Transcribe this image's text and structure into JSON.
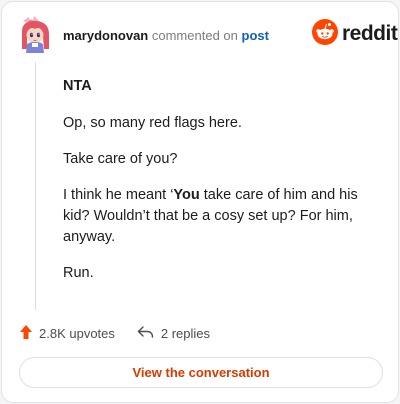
{
  "header": {
    "username": "marydonovan",
    "action_text": "commented on",
    "post_link": "post",
    "brand": "reddit"
  },
  "comment": {
    "title": "NTA",
    "paragraph_1": "Op, so many red flags here.",
    "paragraph_2": "Take care of you?",
    "paragraph_3_before": "I think he meant ‘",
    "paragraph_3_bold": "You",
    "paragraph_3_after": " take care of him and his kid? Wouldn’t that be a cosy set up? For him, anyway.",
    "paragraph_4": "Run."
  },
  "actions": {
    "upvotes": "2.8K upvotes",
    "replies": "2 replies"
  },
  "cta": {
    "label": "View the conversation"
  },
  "colors": {
    "accent": "#d93a00",
    "reddit_orange": "#ff4500",
    "link_blue": "#0f5fbd"
  },
  "icons": [
    "avatar",
    "reddit-snoo-icon",
    "upvote-arrow-icon",
    "reply-icon"
  ]
}
